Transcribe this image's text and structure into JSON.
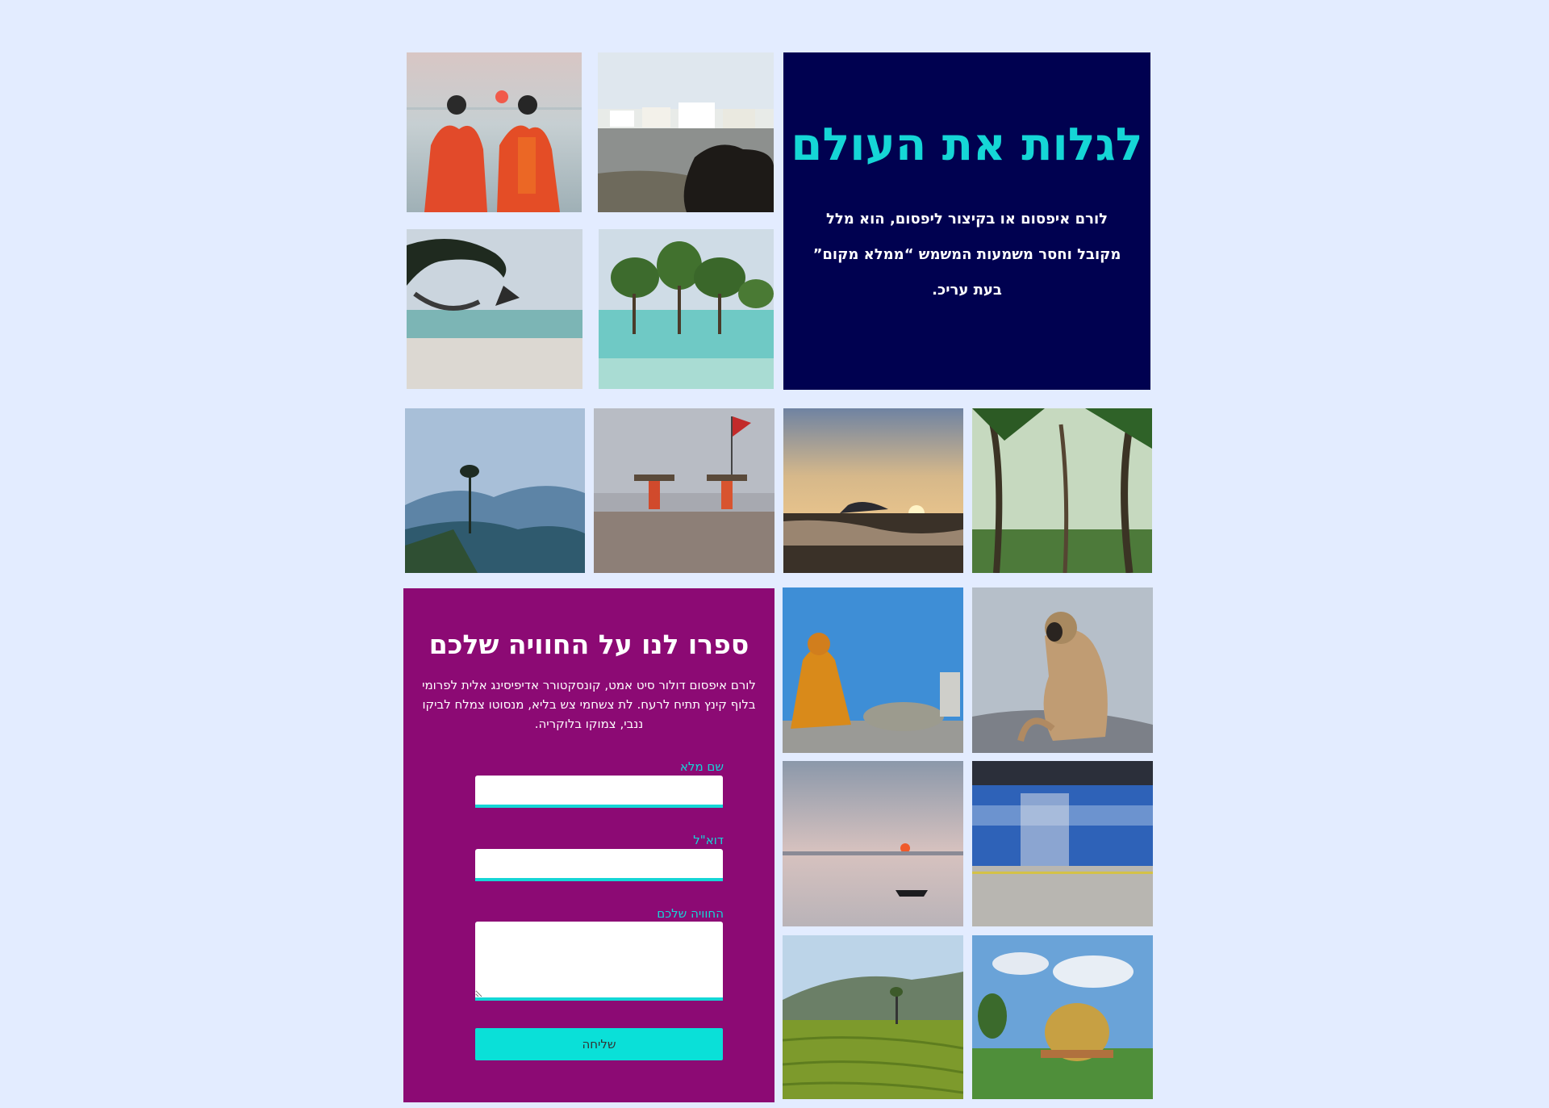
{
  "hero": {
    "title": "לגלות את העולם",
    "text": "לורם איפסום או בקיצור ליפסום, הוא מלל מקובל וחסר משמעות המשמש “ממלא מקום” בעת עריכ."
  },
  "form": {
    "title": "ספרו לנו על החוויה שלכם",
    "description": "לורם איפסום דולור סיט אמט, קונסקטורר אדיפיסינג אלית לפרומי בלוף קינץ תתיח לרעח. לת צשחמי צש בליא, מנסוטו צמלח לביקו ננבי, צמוקו בלוקריה.",
    "name_label": "שם מלא",
    "email_label": "דוא\"ל",
    "experience_label": "החוויה שלכם",
    "send_label": "שליחה"
  },
  "colors": {
    "background": "#e3ecff",
    "hero_bg": "#000150",
    "accent": "#15d6d6",
    "form_bg": "#8c0a74"
  }
}
